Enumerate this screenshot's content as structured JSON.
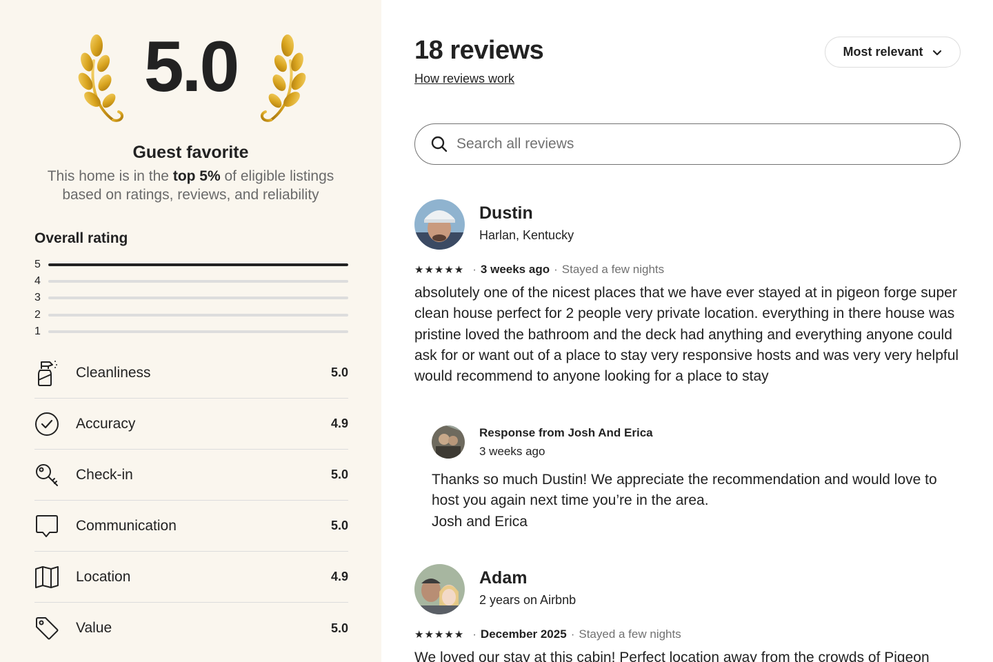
{
  "summary": {
    "score": "5.0",
    "badge_title": "Guest favorite",
    "badge_desc_1": "This home is in the ",
    "badge_desc_bold": "top 5%",
    "badge_desc_2": " of eligible listings based on ratings, reviews, and reliability",
    "overall_title": "Overall rating",
    "distribution": [
      {
        "stars": "5",
        "fraction": 1.0
      },
      {
        "stars": "4",
        "fraction": 0.0
      },
      {
        "stars": "3",
        "fraction": 0.0
      },
      {
        "stars": "2",
        "fraction": 0.0
      },
      {
        "stars": "1",
        "fraction": 0.0
      }
    ],
    "categories": [
      {
        "label": "Cleanliness",
        "value": "5.0",
        "icon": "spray-bottle-icon"
      },
      {
        "label": "Accuracy",
        "value": "4.9",
        "icon": "check-circle-icon"
      },
      {
        "label": "Check-in",
        "value": "5.0",
        "icon": "key-icon"
      },
      {
        "label": "Communication",
        "value": "5.0",
        "icon": "chat-bubble-icon"
      },
      {
        "label": "Location",
        "value": "4.9",
        "icon": "map-icon"
      },
      {
        "label": "Value",
        "value": "5.0",
        "icon": "tag-icon"
      }
    ]
  },
  "header": {
    "title": "18 reviews",
    "how_link": "How reviews work",
    "sort_label": "Most relevant"
  },
  "search": {
    "placeholder": "Search all reviews"
  },
  "reviews": [
    {
      "name": "Dustin",
      "subtitle": "Harlan, Kentucky",
      "stars": "★★★★★",
      "when": "3 weeks ago",
      "stay": "Stayed a few nights",
      "text": "absolutely one of the nicest places that we have ever stayed at in pigeon forge super clean house perfect for 2 people very private location. everything in there house was pristine loved the bathroom and the deck had anything and everything anyone could ask for or want out of a place to stay very responsive hosts and was very very helpful would recommend to anyone looking for a place to stay",
      "response": {
        "name": "Response from Josh And Erica",
        "when": "3 weeks ago",
        "line1": "Thanks so much Dustin! We appreciate the recommendation and would love to host you again next time you’re in the area.",
        "line2": "Josh and Erica"
      }
    },
    {
      "name": "Adam",
      "subtitle": "2 years on Airbnb",
      "stars": "★★★★★",
      "when": "December 2025",
      "stay": "Stayed a few nights",
      "text": "We loved our stay at this cabin! Perfect location away from the crowds of Pigeon"
    }
  ],
  "colors": {
    "left_panel_bg": "#faf6ee",
    "text": "#222222",
    "muted": "#717171",
    "laurel_gold": "#d9a520"
  }
}
